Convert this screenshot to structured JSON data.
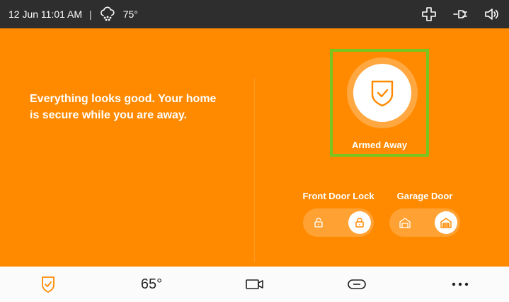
{
  "status_bar": {
    "datetime": "12 Jun 11:01 AM",
    "separator": "|",
    "temperature": "75°",
    "icons": [
      "cloud-snow-icon",
      "medical-cross-icon",
      "plug-icon",
      "volume-icon"
    ]
  },
  "main": {
    "message": "Everything looks good. Your home is secure while you are away.",
    "security_status": {
      "label": "Armed Away",
      "icon": "shield-check-icon"
    },
    "devices": [
      {
        "label": "Front Door Lock",
        "state": "locked",
        "icons": [
          "unlock-icon",
          "lock-icon"
        ]
      },
      {
        "label": "Garage Door",
        "state": "closed",
        "icons": [
          "garage-open-icon",
          "garage-closed-icon"
        ]
      }
    ]
  },
  "bottom_nav": {
    "items": [
      "shield-check-icon",
      "thermostat",
      "camera-icon",
      "automation-icon",
      "more-icon"
    ],
    "thermostat_temp": "65°"
  },
  "colors": {
    "accent": "#ff8a00",
    "status_bar": "#2e2e2e",
    "highlight_border": "#78c520",
    "nav_bg": "#fbfbfb"
  }
}
